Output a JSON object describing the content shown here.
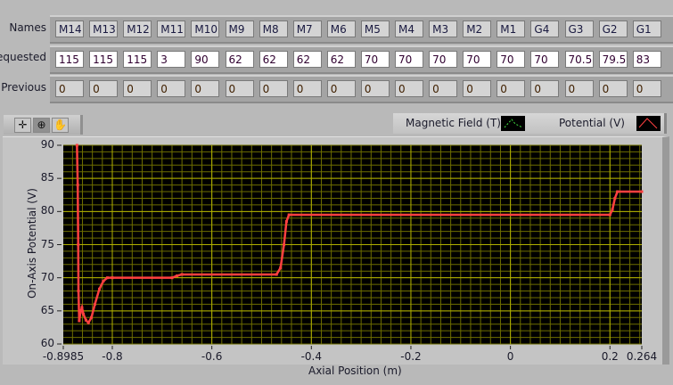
{
  "table": {
    "row_labels": {
      "names": "Names",
      "requested": "Requested",
      "previous": "Previous"
    },
    "names": [
      "M14",
      "M13",
      "M12",
      "M11",
      "M10",
      "M9",
      "M8",
      "M7",
      "M6",
      "M5",
      "M4",
      "M3",
      "M2",
      "M1",
      "G4",
      "G3",
      "G2",
      "G1"
    ],
    "requested": [
      "115",
      "115",
      "115",
      "3",
      "90",
      "62",
      "62",
      "62",
      "62",
      "70",
      "70",
      "70",
      "70",
      "70",
      "70",
      "70.5",
      "79.5",
      "83"
    ],
    "previous": [
      "0",
      "0",
      "0",
      "0",
      "0",
      "0",
      "0",
      "0",
      "0",
      "0",
      "0",
      "0",
      "0",
      "0",
      "0",
      "0",
      "0",
      "0"
    ]
  },
  "toolbar": {
    "tools": [
      "cursor-crosshair-icon",
      "zoom-icon",
      "pan-hand-icon"
    ]
  },
  "legend": {
    "items": [
      {
        "label": "Magnetic Field (T)",
        "color": "#40e040"
      },
      {
        "label": "Potential (V)",
        "color": "#ff4040"
      }
    ]
  },
  "chart_data": {
    "type": "line",
    "xlabel": "Axial Position (m)",
    "ylabel": "On-Axis Potential (V)",
    "xlim": [
      -0.8985,
      0.264
    ],
    "ylim": [
      60,
      90
    ],
    "x_ticks": [
      "-0.8985",
      "-0.8",
      "-0.6",
      "-0.4",
      "-0.2",
      "0",
      "0.2",
      "0.264"
    ],
    "y_ticks": [
      "60",
      "65",
      "70",
      "75",
      "80",
      "85",
      "90"
    ],
    "grid": true,
    "background": "#000000",
    "grid_color": "#b0b000",
    "series": [
      {
        "name": "Potential (V)",
        "color": "#ff4040",
        "x": [
          -0.871,
          -0.8695,
          -0.8685,
          -0.868,
          -0.8665,
          -0.864,
          -0.861,
          -0.858,
          -0.853,
          -0.848,
          -0.842,
          -0.835,
          -0.826,
          -0.818,
          -0.81,
          -0.8,
          -0.68,
          -0.67,
          -0.66,
          -0.47,
          -0.462,
          -0.455,
          -0.45,
          -0.445,
          0.2,
          0.205,
          0.21,
          0.215,
          0.264
        ],
        "y": [
          90,
          84,
          75,
          68,
          63.5,
          64.8,
          65.5,
          64.5,
          63.6,
          63.2,
          64,
          66,
          68.3,
          69.5,
          70,
          70,
          70,
          70.3,
          70.5,
          70.5,
          71.5,
          75,
          78.5,
          79.5,
          79.5,
          80.3,
          82,
          83,
          83
        ]
      }
    ]
  }
}
